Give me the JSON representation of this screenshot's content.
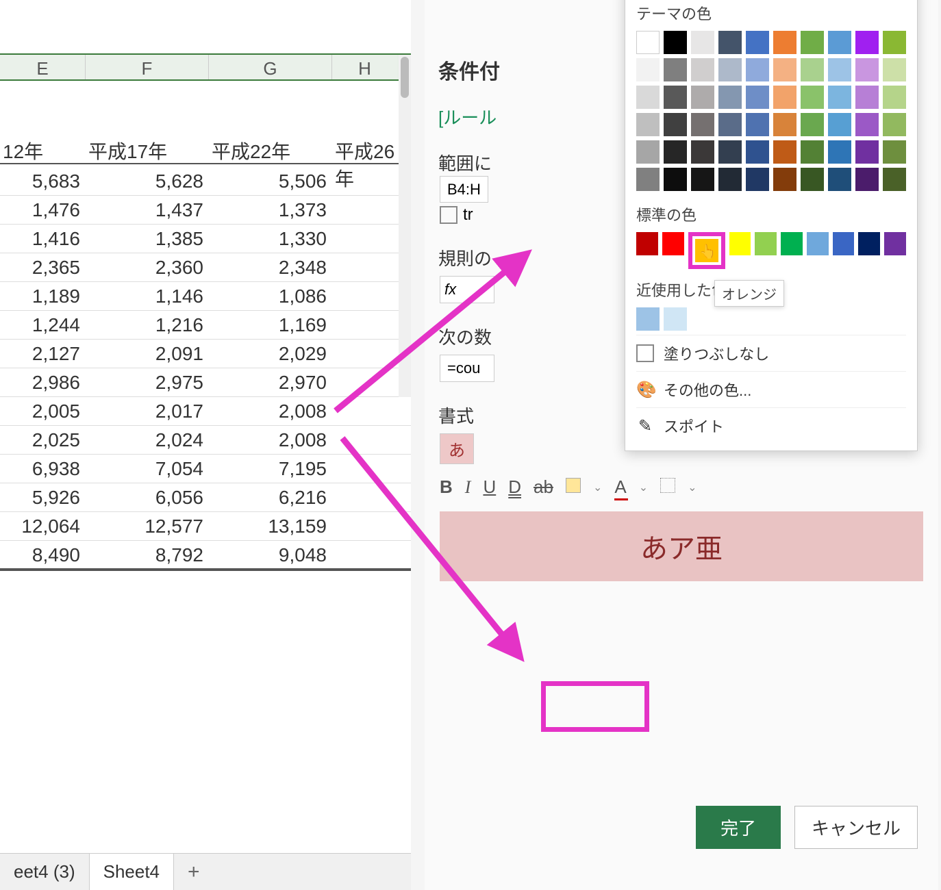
{
  "spreadsheet": {
    "columns": [
      "E",
      "F",
      "G",
      "H"
    ],
    "year_headers": [
      "12年",
      "平成17年",
      "平成22年",
      "平成26年"
    ],
    "rows": [
      [
        "5,683",
        "5,628",
        "5,506",
        ""
      ],
      [
        "1,476",
        "1,437",
        "1,373",
        ""
      ],
      [
        "1,416",
        "1,385",
        "1,330",
        ""
      ],
      [
        "2,365",
        "2,360",
        "2,348",
        ""
      ],
      [
        "1,189",
        "1,146",
        "1,086",
        ""
      ],
      [
        "1,244",
        "1,216",
        "1,169",
        ""
      ],
      [
        "2,127",
        "2,091",
        "2,029",
        ""
      ],
      [
        "2,986",
        "2,975",
        "2,970",
        ""
      ],
      [
        "2,005",
        "2,017",
        "2,008",
        ""
      ],
      [
        "2,025",
        "2,024",
        "2,008",
        ""
      ],
      [
        "6,938",
        "7,054",
        "7,195",
        ""
      ],
      [
        "5,926",
        "6,056",
        "6,216",
        ""
      ],
      [
        "12,064",
        "12,577",
        "13,159",
        ""
      ],
      [
        "8,490",
        "8,792",
        "9,048",
        ""
      ]
    ],
    "tabs": {
      "t1": "eet4 (3)",
      "t2": "Sheet4"
    }
  },
  "panel": {
    "title": "条件付",
    "rule_link": "[ルール",
    "label_range": "範囲に",
    "range_value": "B4:H",
    "tr_label": "tr",
    "label_rule": "規則の",
    "fx_label": "fx",
    "label_next": "次の数",
    "cond_value": "=cou",
    "label_format": "書式",
    "format_preview": "あ",
    "toolbar": {
      "bold": "B",
      "italic": "I",
      "under": "U",
      "dunder": "D",
      "strike": "ab",
      "font_a": "A"
    },
    "big_preview": "あア亜",
    "btn_done": "完了",
    "btn_cancel": "キャンセル"
  },
  "color_picker": {
    "section_theme": "テーマの色",
    "section_standard": "標準の色",
    "section_recent": "近使用した色",
    "tooltip": "オレンジ",
    "opt_nofill": "塗りつぶしなし",
    "opt_more": "その他の色...",
    "opt_eyedrop": "スポイト",
    "theme_rows": [
      [
        "#ffffff",
        "#000000",
        "#e7e6e6",
        "#44546a",
        "#4472c4",
        "#ed7d31",
        "#70ad47",
        "#5b9bd5",
        "#a020f0",
        "#8ab833"
      ],
      [
        "#f2f2f2",
        "#7f7f7f",
        "#d0cece",
        "#adb9ca",
        "#8faadc",
        "#f4b183",
        "#a9d18e",
        "#9dc3e6",
        "#c996e0",
        "#cde0a8"
      ],
      [
        "#d9d9d9",
        "#595959",
        "#aeabab",
        "#8497b0",
        "#6e8ec7",
        "#f2a36a",
        "#8ac26a",
        "#7cb5df",
        "#b77fd6",
        "#b5d48a"
      ],
      [
        "#bfbfbf",
        "#404040",
        "#757070",
        "#5a6c89",
        "#4f72b0",
        "#d8833a",
        "#6aa84f",
        "#579fd3",
        "#9b59c6",
        "#92b95f"
      ],
      [
        "#a6a6a6",
        "#262626",
        "#3b3838",
        "#333f50",
        "#2f528f",
        "#bf5b17",
        "#538135",
        "#2e75b6",
        "#7030a0",
        "#6e8f3e"
      ],
      [
        "#808080",
        "#0d0d0d",
        "#161616",
        "#222a35",
        "#203864",
        "#833c0b",
        "#385723",
        "#1f4e79",
        "#4b1c6b",
        "#4a6128"
      ]
    ],
    "standard": [
      "#c00000",
      "#ff0000",
      "#ffc000",
      "#ffff00",
      "#92d050",
      "#00b050",
      "#6fa8dc",
      "#3a66c4",
      "#002060",
      "#7030a0"
    ],
    "recent": [
      "#9dc3e6",
      "#d0e6f5"
    ]
  }
}
